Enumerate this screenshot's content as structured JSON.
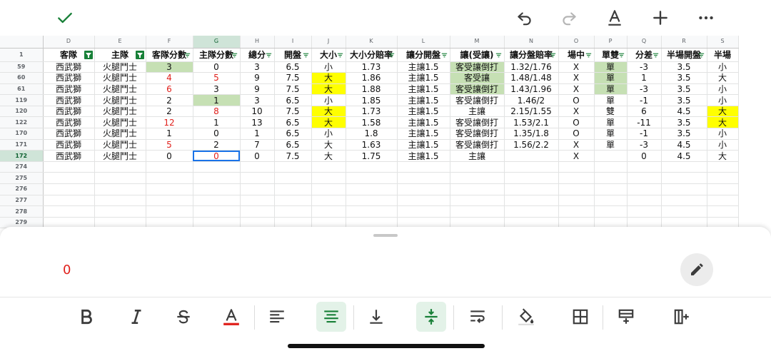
{
  "toolbar": {
    "icons": [
      "check-icon",
      "undo-icon",
      "redo-icon",
      "text-format-icon",
      "add-icon",
      "more-icon"
    ],
    "accent_color": "#188038"
  },
  "sheet": {
    "columns": [
      "D",
      "E",
      "F",
      "G",
      "H",
      "I",
      "J",
      "K",
      "L",
      "M",
      "N",
      "O",
      "P",
      "Q",
      "R",
      "S"
    ],
    "selected_column": "G",
    "header_row_num": "1",
    "headers": [
      "客隊",
      "主隊",
      "客隊分數",
      "主隊分數",
      "總分",
      "開盤",
      "大小",
      "大小分賠率",
      "讓分開盤",
      "讓(受讓)",
      "讓分盤賠率",
      "場中",
      "單雙",
      "分差",
      "半場開盤",
      "半場"
    ],
    "rows": [
      {
        "num": "59",
        "cells": [
          "西武獅",
          "火腿鬥士",
          "3",
          "0",
          "3",
          "6.5",
          "小",
          "1.73",
          "主讓1.5",
          "客受讓倒打",
          "1.32/1.76",
          "X",
          "單",
          "-3",
          "3.5",
          "小"
        ]
      },
      {
        "num": "60",
        "cells": [
          "西武獅",
          "火腿鬥士",
          "4",
          "5",
          "9",
          "7.5",
          "大",
          "1.86",
          "主讓1.5",
          "客受讓",
          "1.48/1.48",
          "X",
          "單",
          "1",
          "3.5",
          "大"
        ]
      },
      {
        "num": "61",
        "cells": [
          "西武獅",
          "火腿鬥士",
          "6",
          "3",
          "9",
          "7.5",
          "大",
          "1.88",
          "主讓1.5",
          "客受讓倒打",
          "1.43/1.96",
          "X",
          "單",
          "-3",
          "3.5",
          "小"
        ]
      },
      {
        "num": "119",
        "cells": [
          "西武獅",
          "火腿鬥士",
          "2",
          "1",
          "3",
          "6.5",
          "小",
          "1.85",
          "主讓1.5",
          "客受讓倒打",
          "1.46/2",
          "O",
          "單",
          "-1",
          "3.5",
          "小"
        ]
      },
      {
        "num": "120",
        "cells": [
          "西武獅",
          "火腿鬥士",
          "2",
          "8",
          "10",
          "7.5",
          "大",
          "1.73",
          "主讓1.5",
          "主讓",
          "2.15/1.55",
          "X",
          "雙",
          "6",
          "4.5",
          "大"
        ]
      },
      {
        "num": "122",
        "cells": [
          "西武獅",
          "火腿鬥士",
          "12",
          "1",
          "13",
          "6.5",
          "大",
          "1.58",
          "主讓1.5",
          "客受讓倒打",
          "1.53/2.1",
          "O",
          "單",
          "-11",
          "3.5",
          "大"
        ]
      },
      {
        "num": "170",
        "cells": [
          "西武獅",
          "火腿鬥士",
          "1",
          "0",
          "1",
          "6.5",
          "小",
          "1.8",
          "主讓1.5",
          "客受讓倒打",
          "1.35/1.8",
          "O",
          "單",
          "-1",
          "3.5",
          "小"
        ]
      },
      {
        "num": "171",
        "cells": [
          "西武獅",
          "火腿鬥士",
          "5",
          "2",
          "7",
          "6.5",
          "大",
          "1.63",
          "主讓1.5",
          "客受讓倒打",
          "1.56/2.2",
          "X",
          "單",
          "-3",
          "4.5",
          "小"
        ]
      },
      {
        "num": "172",
        "cells": [
          "西武獅",
          "火腿鬥士",
          "0",
          "0",
          "0",
          "7.5",
          "大",
          "1.75",
          "主讓1.5",
          "主讓",
          "",
          "X",
          "",
          "0",
          "4.5",
          "大"
        ]
      }
    ],
    "empty_rows": [
      "274",
      "275",
      "276",
      "277",
      "278",
      "279"
    ],
    "highlight_green": "#c6e0b4",
    "highlight_yellow": "#ffff00",
    "red_text": "#e0201b"
  },
  "editor": {
    "value": "0",
    "edit_icon": "pencil-icon"
  },
  "format_toolbar": {
    "icons": [
      "bold-icon",
      "italic-icon",
      "strikethrough-icon",
      "text-color-icon",
      "align-left-icon",
      "align-center-icon",
      "valign-bottom-icon",
      "valign-middle-icon",
      "wrap-text-icon",
      "fill-color-icon",
      "borders-icon",
      "insert-row-icon",
      "insert-column-icon"
    ],
    "active": [
      "align-center-icon",
      "valign-middle-icon"
    ]
  }
}
